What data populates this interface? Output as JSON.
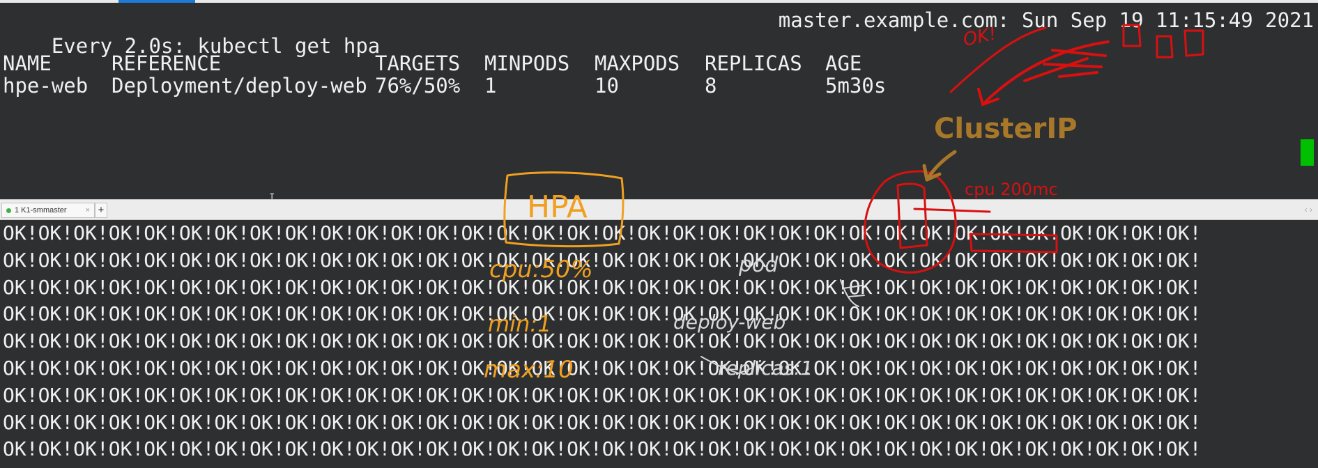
{
  "watch": {
    "command": "Every 2.0s: kubectl get hpa",
    "host_time": "master.example.com: Sun Sep 19 11:15:49 2021"
  },
  "hpa_table": {
    "headers": [
      "NAME",
      "REFERENCE",
      "TARGETS",
      "MINPODS",
      "MAXPODS",
      "REPLICAS",
      "AGE"
    ],
    "rows": [
      [
        "hpe-web",
        "Deployment/deploy-web",
        "76%/50%",
        "1",
        "10",
        "8",
        "5m30s"
      ]
    ]
  },
  "tabs": [
    {
      "label": "1 K1-smmaster",
      "status_color": "#3cb043"
    }
  ],
  "tab_add_label": "+",
  "tab_close_label": "×",
  "tab_scroll_label": "‹ ›",
  "text_cursor_glyph": "I",
  "output": {
    "repeat_unit": "OK!",
    "line_count": 9
  },
  "annotations": {
    "hpa_box": "HPA",
    "cpu_target": "cpu:50%",
    "min": "min:1",
    "max": "max:10",
    "pod": "pod",
    "deploy": "deploy-web",
    "replicas": "replicas:1",
    "cluster_ip": "ClusterIP",
    "cpu_limit": "cpu 200mc",
    "ok": "OK!",
    "colors": {
      "orange": "#f0a020",
      "red": "#d81010",
      "brown": "#a8782a",
      "white": "#d8d8d8"
    }
  }
}
